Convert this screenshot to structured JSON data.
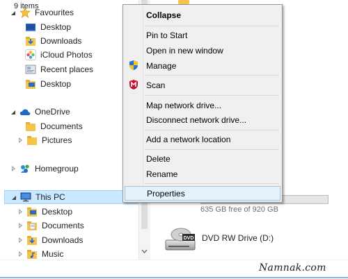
{
  "nav": {
    "favourites": "Favourites",
    "fav_items": [
      "Desktop",
      "Downloads",
      "iCloud Photos",
      "Recent places",
      "Desktop"
    ],
    "onedrive": "OneDrive",
    "onedrive_items": [
      "Documents",
      "Pictures"
    ],
    "homegroup": "Homegroup",
    "thispc": "This PC",
    "thispc_items": [
      "Desktop",
      "Documents",
      "Downloads",
      "Music"
    ]
  },
  "content": {
    "cdrive_free": "635 GB free of 920 GB",
    "dvd_drive": "DVD RW Drive (D:)",
    "dvd_icon_text": "DVD"
  },
  "status": {
    "items": "9 items"
  },
  "watermark": "Namnak.com",
  "menu": {
    "collapse": "Collapse",
    "pin_to_start": "Pin to Start",
    "open_new_window": "Open in new window",
    "manage": "Manage",
    "scan": "Scan",
    "map_drive": "Map network drive...",
    "disconnect_drive": "Disconnect network drive...",
    "add_network_location": "Add a network location",
    "delete": "Delete",
    "rename": "Rename",
    "properties": "Properties"
  },
  "colors": {
    "selection": "#cce8ff",
    "menu_background": "#f0f0f0",
    "menu_hover": "#e5f1fb",
    "folder": "#f4c44b"
  }
}
